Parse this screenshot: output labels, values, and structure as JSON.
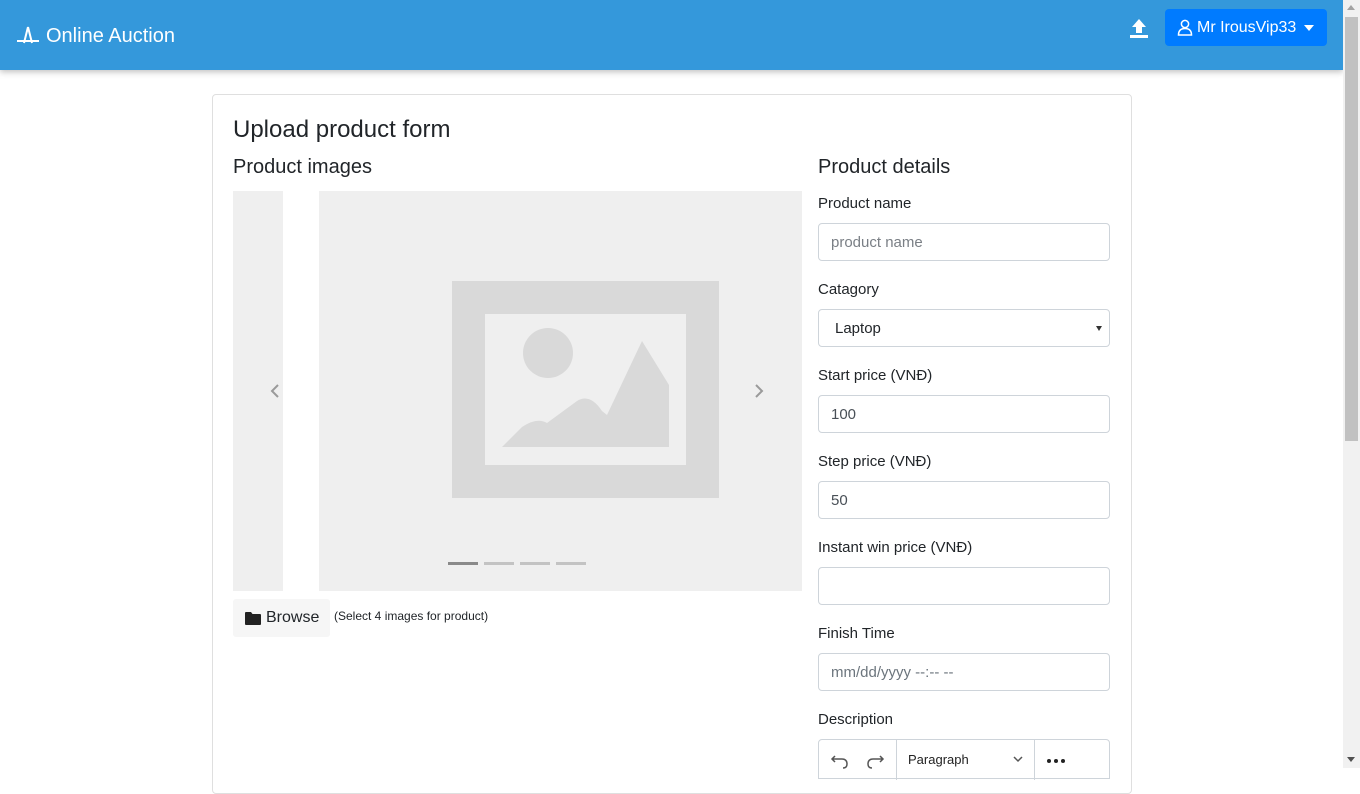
{
  "navbar": {
    "brand": "Online Auction",
    "brand_icon": "auction-logo-icon",
    "upload_icon": "upload-icon",
    "user": {
      "icon": "user-icon",
      "label": "Mr IrousVip33"
    },
    "colors": {
      "background": "#3498db",
      "user_button": "#007bff"
    }
  },
  "form": {
    "title": "Upload product form",
    "images": {
      "heading": "Product images",
      "indicators": [
        true,
        false,
        false,
        false
      ],
      "browse_label": "Browse",
      "hint": "(Select 4 images for product)"
    },
    "details": {
      "heading": "Product details",
      "product_name": {
        "label": "Product name",
        "placeholder": "product name",
        "value": ""
      },
      "category": {
        "label": "Catagory",
        "value": "Laptop"
      },
      "start_price": {
        "label": "Start price (VNĐ)",
        "value": "100"
      },
      "step_price": {
        "label": "Step price (VNĐ)",
        "value": "50"
      },
      "instant_win_price": {
        "label": "Instant win price (VNĐ)",
        "value": ""
      },
      "finish_time": {
        "label": "Finish Time",
        "placeholder": "mm/dd/yyyy --:-- --"
      },
      "description": {
        "label": "Description",
        "toolbar": {
          "block_format": "Paragraph"
        }
      }
    }
  }
}
